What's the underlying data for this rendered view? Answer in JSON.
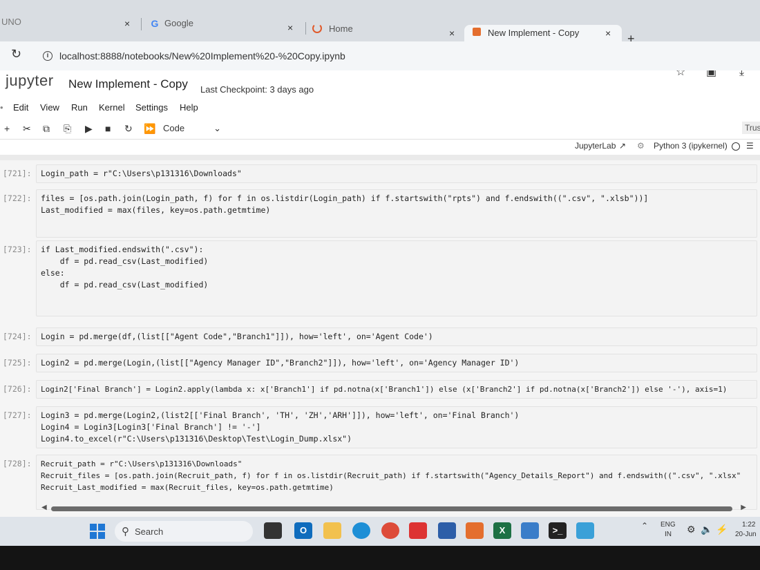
{
  "browser": {
    "tabs": [
      {
        "label": "UNO",
        "close": "×"
      },
      {
        "label": "Google",
        "close": "×",
        "icon": "G"
      },
      {
        "label": "Home",
        "close": "×"
      },
      {
        "label": "New Implement - Copy",
        "close": "×"
      }
    ],
    "new_tab": "+",
    "minimize": "—",
    "url": "localhost:8888/notebooks/New%20Implement%20-%20Copy.ipynb"
  },
  "jupyter": {
    "logo": "jupyter",
    "notebook_title": "New Implement - Copy",
    "checkpoint": "Last Checkpoint: 3 days ago",
    "menu": [
      "Edit",
      "View",
      "Run",
      "Kernel",
      "Settings",
      "Help"
    ],
    "cell_type": "Code",
    "trusted": "Trus",
    "jupyterlab_link": "JupyterLab",
    "kernel_name": "Python 3 (ipykernel)"
  },
  "cells": [
    {
      "prompt": "[721]:",
      "code": "Login_path = r\"C:\\Users\\p131316\\Downloads\""
    },
    {
      "prompt": "[722]:",
      "code": "files = [os.path.join(Login_path, f) for f in os.listdir(Login_path) if f.startswith(\"rpts\") and f.endswith((\".csv\", \".xlsb\"))]\nLast_modified = max(files, key=os.path.getmtime)"
    },
    {
      "prompt": "[723]:",
      "code": "if Last_modified.endswith(\".csv\"):\n    df = pd.read_csv(Last_modified)\nelse:\n    df = pd.read_csv(Last_modified)"
    },
    {
      "prompt": "[724]:",
      "code": "Login = pd.merge(df,(list[[\"Agent Code\",\"Branch1\"]]), how='left', on='Agent Code')"
    },
    {
      "prompt": "[725]:",
      "code": "Login2 = pd.merge(Login,(list[[\"Agency Manager ID\",\"Branch2\"]]), how='left', on='Agency Manager ID')"
    },
    {
      "prompt": "[726]:",
      "code": "Login2['Final Branch'] = Login2.apply(lambda x: x['Branch1'] if pd.notna(x['Branch1']) else (x['Branch2'] if pd.notna(x['Branch2']) else '-'), axis=1)"
    },
    {
      "prompt": "[727]:",
      "code": "Login3 = pd.merge(Login2,(list2[['Final Branch', 'TH', 'ZH','ARH']]), how='left', on='Final Branch')\nLogin4 = Login3[Login3['Final Branch'] != '-']\nLogin4.to_excel(r\"C:\\Users\\p131316\\Desktop\\Test\\Login_Dump.xlsx\")"
    },
    {
      "prompt": "[728]:",
      "code": "Recruit_path = r\"C:\\Users\\p131316\\Downloads\"\nRecruit_files = [os.path.join(Recruit_path, f) for f in os.listdir(Recruit_path) if f.startswith(\"Agency_Details_Report\") and f.endswith((\".csv\", \".xlsx\"\nRecruit_Last_modified = max(Recruit_files, key=os.path.getmtime)"
    }
  ],
  "taskbar": {
    "search_label": "Search",
    "language": "ENG",
    "region": "IN",
    "time": "1:22",
    "date": "20-Jun"
  }
}
